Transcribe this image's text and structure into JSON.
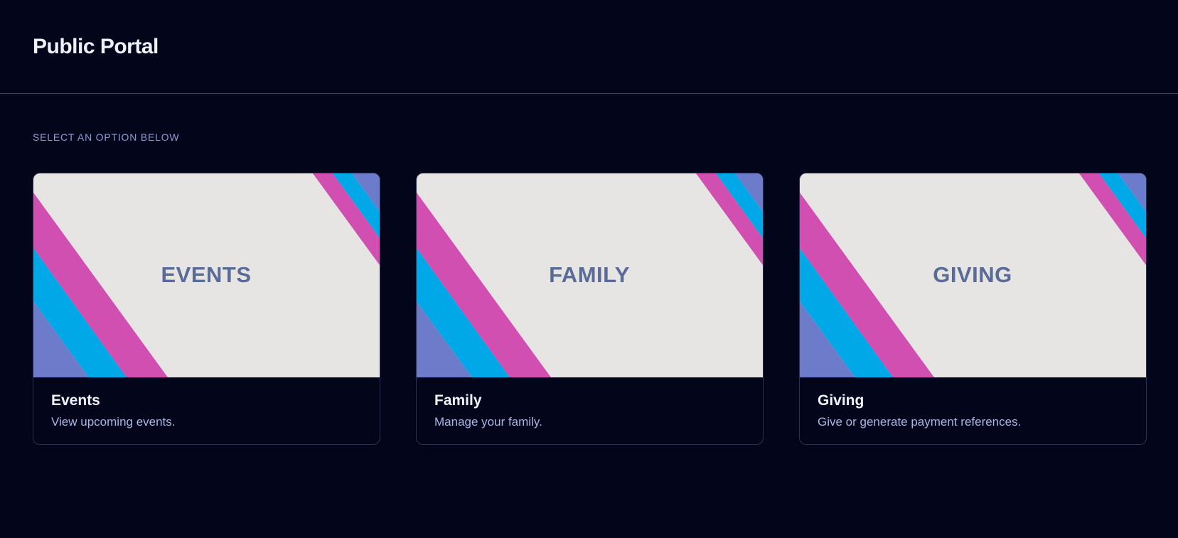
{
  "header": {
    "title": "Public Portal"
  },
  "main": {
    "section_label": "SELECT AN OPTION BELOW",
    "cards": [
      {
        "banner_text": "EVENTS",
        "title": "Events",
        "description": "View upcoming events."
      },
      {
        "banner_text": "FAMILY",
        "title": "Family",
        "description": "Manage your family."
      },
      {
        "banner_text": "GIVING",
        "title": "Giving",
        "description": "Give or generate payment references."
      }
    ]
  },
  "colors": {
    "background": "#03061a",
    "banner_background": "#e7e5e4",
    "stripe_magenta": "#d04fb0",
    "stripe_cyan": "#00a8e8",
    "stripe_periwinkle": "#6c7cca",
    "banner_text": "#596b96",
    "label_text": "#8c9bd4",
    "description_text": "#a9b4e4"
  }
}
